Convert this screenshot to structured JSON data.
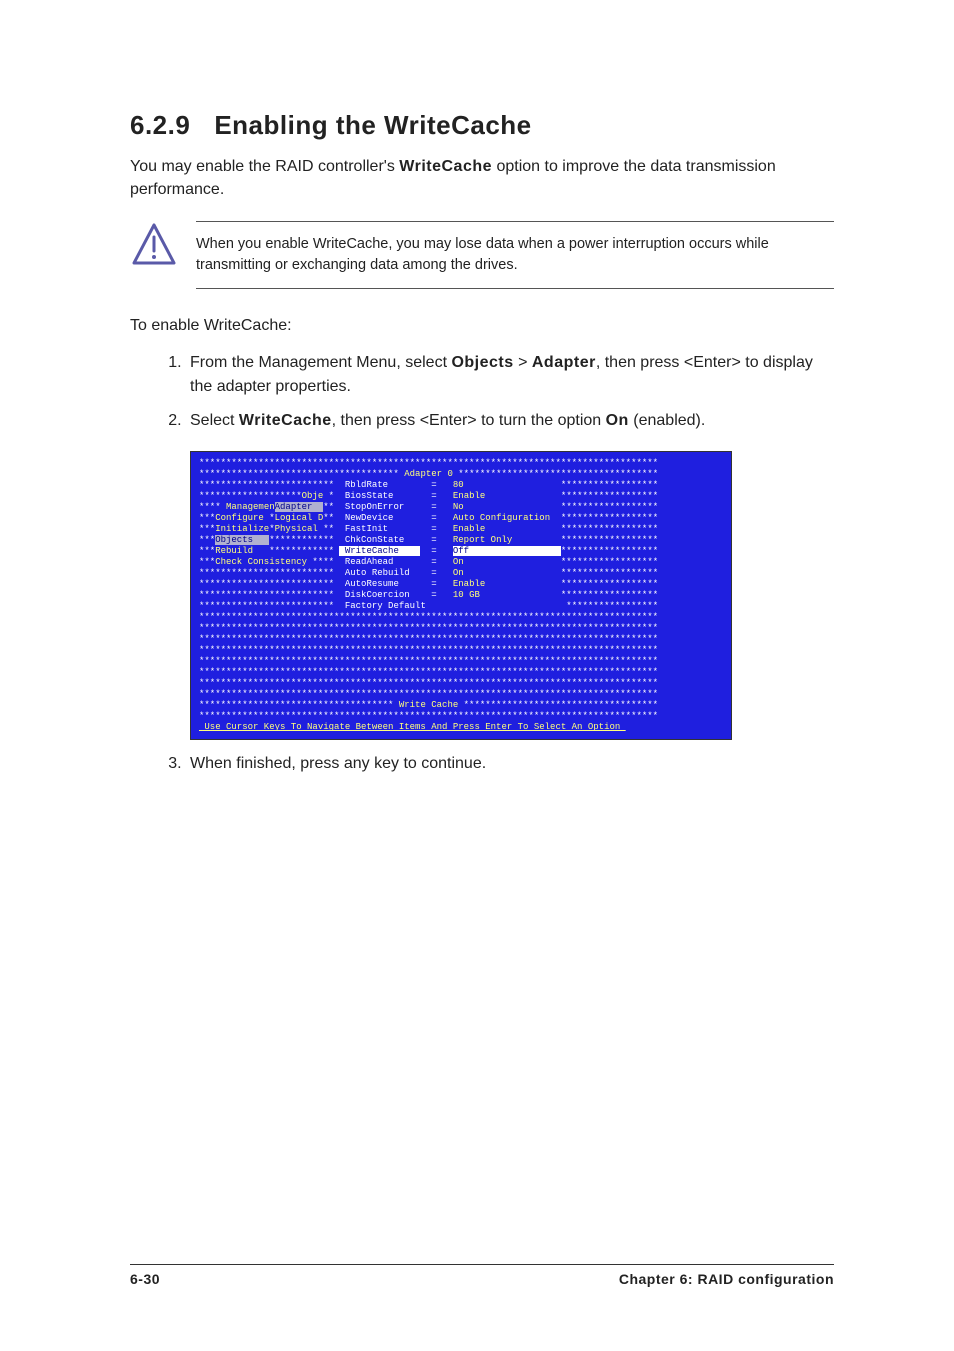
{
  "section": {
    "number": "6.2.9",
    "title": "Enabling the WriteCache"
  },
  "intro": {
    "pre": "You may enable the RAID controller's ",
    "bold": "WriteCache",
    "post": " option to improve the data transmission performance."
  },
  "note": "When you enable WriteCache, you may lose data when a power interruption occurs while transmitting or exchanging data among the drives.",
  "lead": "To enable WriteCache:",
  "steps": {
    "s1": {
      "pre": "From the Management Menu, select ",
      "b1": "Objects",
      "mid": " > ",
      "b2": "Adapter",
      "post": ", then press <Enter> to display the adapter properties."
    },
    "s2": {
      "pre": "Select ",
      "b1": "WriteCache",
      "mid": ", then press <Enter> to turn the option ",
      "b2": "On",
      "post": " (enabled)."
    },
    "s3": "When finished, press any key to continue."
  },
  "bios": {
    "header": "Adapter 0",
    "menu": [
      "Managemen",
      "Configure",
      "Initialize",
      "Objects",
      "Rebuild",
      "Check Consistency"
    ],
    "submenu": [
      "Obje",
      "Adapter",
      "Logical D",
      "Physical"
    ],
    "rows": [
      {
        "name": "RbldRate",
        "value": "80"
      },
      {
        "name": "BiosState",
        "value": "Enable"
      },
      {
        "name": "StopOnError",
        "value": "No"
      },
      {
        "name": "NewDevice",
        "value": "Auto Configuration"
      },
      {
        "name": "FastInit",
        "value": "Enable"
      },
      {
        "name": "ChkConState",
        "value": "Report Only"
      },
      {
        "name": "WriteCache",
        "value": "Off"
      },
      {
        "name": "ReadAhead",
        "value": "On"
      },
      {
        "name": "Auto Rebuild",
        "value": "On"
      },
      {
        "name": "AutoResume",
        "value": "Enable"
      },
      {
        "name": "DiskCoercion",
        "value": "10 GB"
      },
      {
        "name": "Factory Default",
        "value": ""
      }
    ],
    "status": "Write Cache",
    "footer": "Use Cursor Keys To Navigate Between Items And Press Enter To Select An Option"
  },
  "page_footer": {
    "left": "6-30",
    "right": "Chapter 6: RAID configuration"
  }
}
